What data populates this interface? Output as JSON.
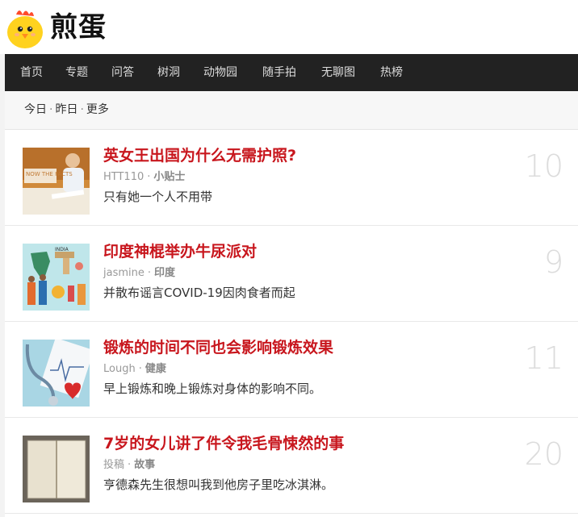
{
  "brand": {
    "name": "煎蛋"
  },
  "nav": {
    "items": [
      {
        "label": "首页"
      },
      {
        "label": "专题"
      },
      {
        "label": "问答"
      },
      {
        "label": "树洞"
      },
      {
        "label": "动物园"
      },
      {
        "label": "随手拍"
      },
      {
        "label": "无聊图"
      },
      {
        "label": "热榜"
      }
    ]
  },
  "subnav": {
    "today": "今日",
    "yesterday": "昨日",
    "more": "更多",
    "separator": "·"
  },
  "articles": [
    {
      "title": "英女王出国为什么无需护照?",
      "author": "HTT110",
      "tag": "小贴士",
      "summary": "只有她一个人不用带",
      "count": "10",
      "thumb_text": "NOW THE FACTS"
    },
    {
      "title": "印度神棍举办牛尿派对",
      "author": "jasmine",
      "tag": "印度",
      "summary": "并散布谣言COVID-19因肉食者而起",
      "count": "9",
      "thumb_text": "INDIA"
    },
    {
      "title": "锻炼的时间不同也会影响锻炼效果",
      "author": "Lough",
      "tag": "健康",
      "summary": "早上锻炼和晚上锻炼对身体的影响不同。",
      "count": "11"
    },
    {
      "title": "7岁的女儿讲了件令我毛骨悚然的事",
      "author": "投稿",
      "tag": "故事",
      "summary": "亨德森先生很想叫我到他房子里吃冰淇淋。",
      "count": "20"
    }
  ],
  "colors": {
    "title": "#c8161d",
    "nav_bg": "#222222",
    "count": "#dcdcdc"
  }
}
